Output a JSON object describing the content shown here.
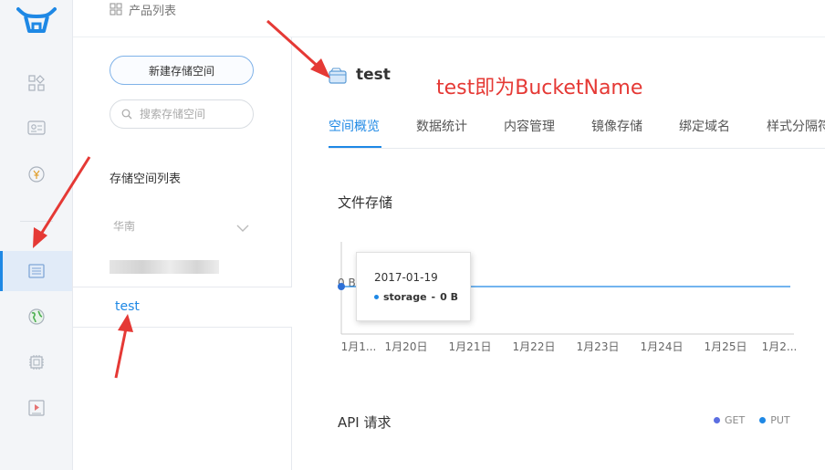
{
  "breadcrumb": {
    "label": "产品列表"
  },
  "rail": {
    "items": [
      {
        "icon": "grid-icon"
      },
      {
        "icon": "id-card-icon"
      },
      {
        "icon": "yen-icon"
      },
      {
        "icon": "storage-icon",
        "active": true
      },
      {
        "icon": "globe-icon"
      },
      {
        "icon": "chip-icon"
      },
      {
        "icon": "video-icon"
      }
    ]
  },
  "sidebar": {
    "new_bucket_label": "新建存储空间",
    "search_placeholder": "搜索存储空间",
    "list_title": "存储空间列表",
    "region": "华南",
    "buckets": [
      "test"
    ]
  },
  "bucket": {
    "name": "test"
  },
  "annotation": "test即为BucketName",
  "tabs": [
    "空间概览",
    "数据统计",
    "内容管理",
    "镜像存储",
    "绑定域名",
    "样式分隔符"
  ],
  "sections": {
    "file_storage": "文件存储",
    "api_requests": "API 请求"
  },
  "legend": [
    {
      "name": "GET",
      "color": "#5b6ee1"
    },
    {
      "name": "PUT",
      "color": "#1e88e5"
    }
  ],
  "tooltip": {
    "date": "2017-01-19",
    "series": "storage",
    "value": "0 B"
  },
  "chart_data": {
    "type": "line",
    "categories": [
      "1月1...",
      "1月20日",
      "1月21日",
      "1月22日",
      "1月23日",
      "1月24日",
      "1月25日",
      "1月2..."
    ],
    "series": [
      {
        "name": "storage",
        "values": [
          0,
          0,
          0,
          0,
          0,
          0,
          0,
          0
        ]
      }
    ],
    "y_tick_label": "0 B",
    "line_color": "#1e88e5"
  },
  "colors": {
    "accent": "#1e88e5",
    "annotation": "#e53935",
    "arrow": "#e53935"
  }
}
